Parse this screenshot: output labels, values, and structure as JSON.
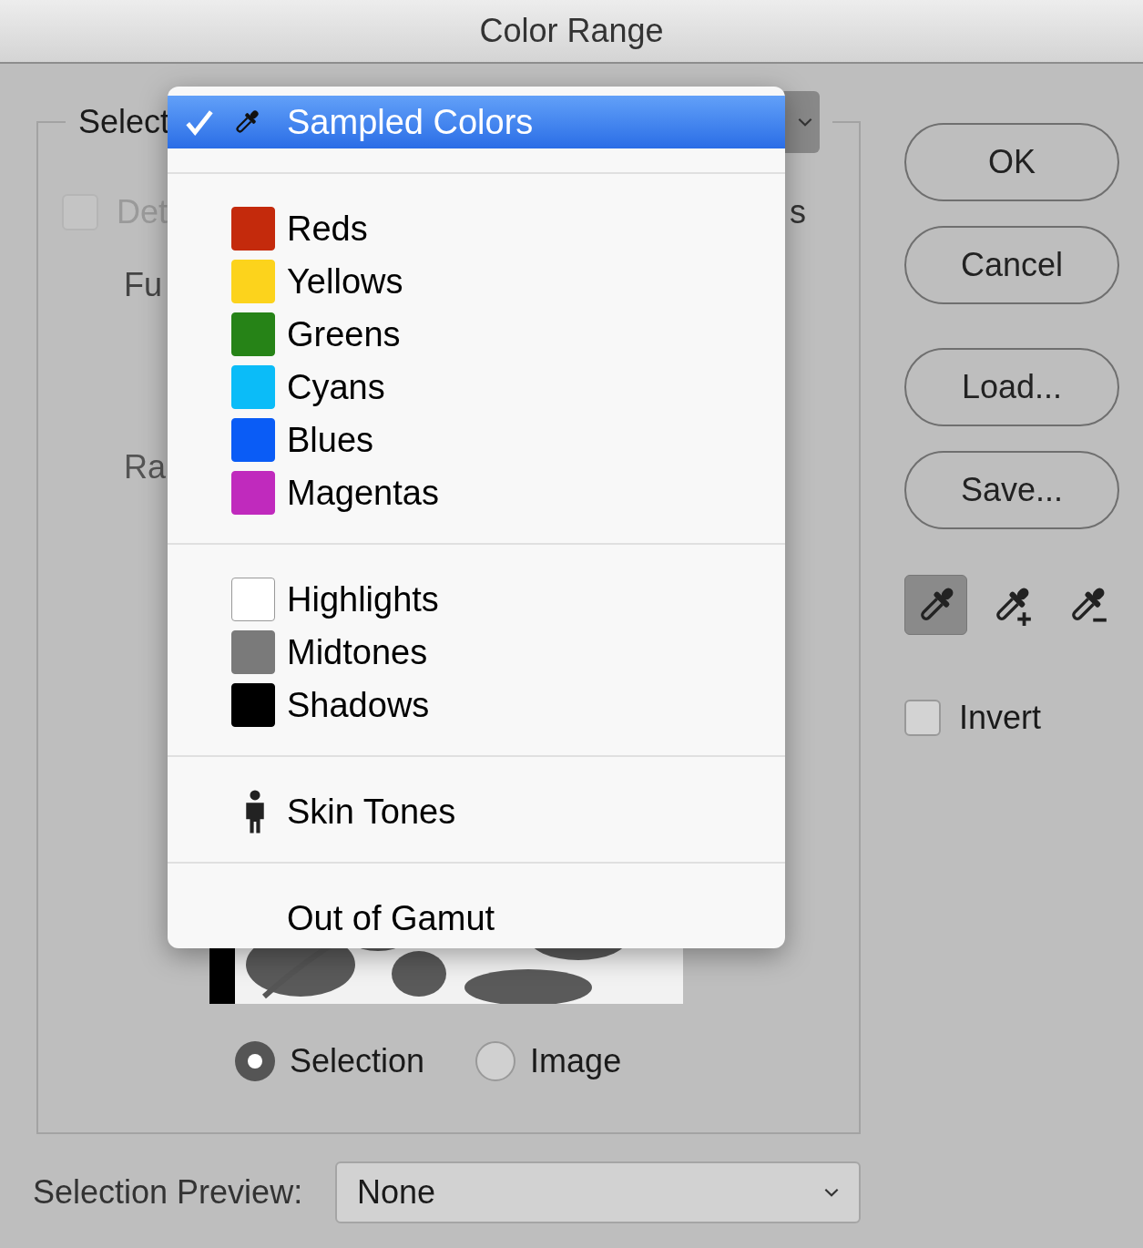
{
  "window": {
    "title": "Color Range"
  },
  "select_group": {
    "label": "Select",
    "detect": {
      "label": "Det",
      "checked": false,
      "disabled": true
    },
    "clusters_tail": "s",
    "fuzziness_label": "Fu",
    "range_label": "Ra",
    "preview_modes": [
      {
        "label": "Selection",
        "selected": true
      },
      {
        "label": "Image",
        "selected": false
      }
    ]
  },
  "menu": {
    "sections": [
      [
        {
          "kind": "eyedropper",
          "label": "Sampled Colors",
          "selected": true
        }
      ],
      [
        {
          "kind": "swatch",
          "label": "Reds",
          "color": "#c42a0c",
          "selected": false
        },
        {
          "kind": "swatch",
          "label": "Yellows",
          "color": "#fcd31c",
          "selected": false
        },
        {
          "kind": "swatch",
          "label": "Greens",
          "color": "#268317",
          "selected": false
        },
        {
          "kind": "swatch",
          "label": "Cyans",
          "color": "#0bbcf8",
          "selected": false
        },
        {
          "kind": "swatch",
          "label": "Blues",
          "color": "#0a5cf6",
          "selected": false
        },
        {
          "kind": "swatch",
          "label": "Magentas",
          "color": "#c02abd",
          "selected": false
        }
      ],
      [
        {
          "kind": "swatch",
          "label": "Highlights",
          "color": "#ffffff",
          "selected": false
        },
        {
          "kind": "swatch",
          "label": "Midtones",
          "color": "#7a7a7a",
          "selected": false
        },
        {
          "kind": "swatch",
          "label": "Shadows",
          "color": "#000000",
          "selected": false
        }
      ],
      [
        {
          "kind": "figure",
          "label": "Skin Tones",
          "selected": false
        }
      ],
      [
        {
          "kind": "plain",
          "label": "Out of Gamut",
          "selected": false
        }
      ]
    ]
  },
  "buttons": [
    "OK",
    "Cancel",
    "Load...",
    "Save..."
  ],
  "eyedroppers": [
    {
      "kind": "sample",
      "selected": true
    },
    {
      "kind": "add",
      "selected": false
    },
    {
      "kind": "subtract",
      "selected": false
    }
  ],
  "invert": {
    "label": "Invert",
    "checked": false
  },
  "selection_preview": {
    "label": "Selection Preview:",
    "value": "None"
  }
}
